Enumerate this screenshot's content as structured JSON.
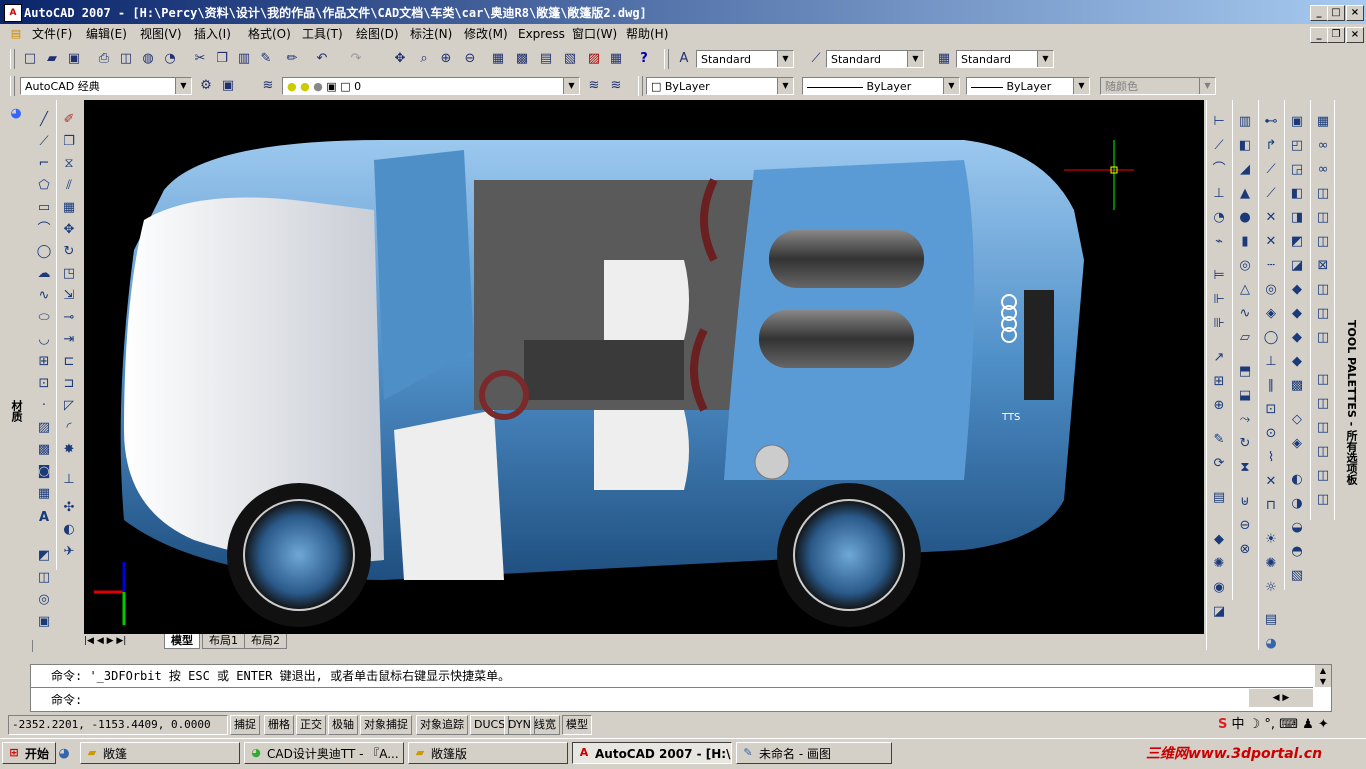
{
  "window": {
    "title": "AutoCAD 2007 - [H:\\Percy\\资料\\设计\\我的作品\\作品文件\\CAD文档\\车类\\car\\奥迪R8\\敞篷\\敞篷版2.dwg]",
    "app_icon": "autocad-icon"
  },
  "menu": [
    "文件(F)",
    "编辑(E)",
    "视图(V)",
    "插入(I)",
    "格式(O)",
    "工具(T)",
    "绘图(D)",
    "标注(N)",
    "修改(M)",
    "Express",
    "窗口(W)",
    "帮助(H)"
  ],
  "styles_toolbar": {
    "text_style": "Standard",
    "dim_style": "Standard",
    "table_style": "Standard"
  },
  "workspace_toolbar": {
    "workspace": "AutoCAD 经典",
    "layer": "0",
    "color": "ByLayer",
    "linetype": "ByLayer",
    "lineweight": "ByLayer",
    "plot_style": "随颜色"
  },
  "side_labels": {
    "materials": "材质",
    "tool_palettes": "TOOL PALETTES - 所有选项板"
  },
  "viewport": {
    "background": "#000000",
    "car_body_color": "#5b9bd5",
    "car_white_color": "#f0f0f0",
    "badge_text": "TTS"
  },
  "layout_tabs": [
    "模型",
    "布局1",
    "布局2"
  ],
  "command": {
    "history": "命令: '_3DFOrbit 按 ESC 或 ENTER 键退出, 或者单击鼠标右键显示快捷菜单。",
    "prompt": "命令:"
  },
  "status": {
    "coords": "-2352.2201, -1153.4409, 0.0000",
    "toggles": [
      "捕捉",
      "栅格",
      "正交",
      "极轴",
      "对象捕捉",
      "对象追踪",
      "DUCS",
      "DYN",
      "线宽",
      "模型"
    ]
  },
  "taskbar": {
    "start": "开始",
    "tasks": [
      {
        "label": "敞篷",
        "icon": "folder-icon"
      },
      {
        "label": "CAD设计奥迪TT - 『A...",
        "icon": "browser-icon"
      },
      {
        "label": "敞篷版",
        "icon": "folder-icon"
      },
      {
        "label": "AutoCAD 2007 - [H:\\...",
        "icon": "autocad-icon"
      },
      {
        "label": "未命名 - 画图",
        "icon": "paint-icon"
      }
    ],
    "watermark": "三维网www.3dportal.cn"
  }
}
